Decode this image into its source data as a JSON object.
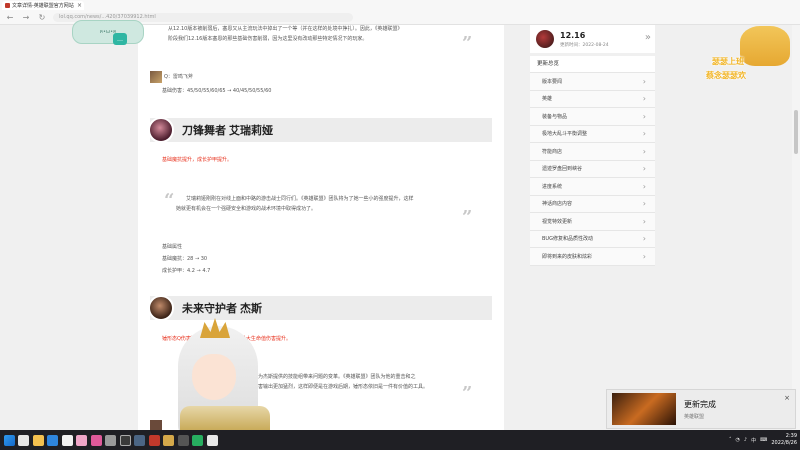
{
  "browser": {
    "tab_title": "文章详情-英雄联盟官方网站",
    "tab_close": "×",
    "url": "lol.qq.com/news/...420/37039912.html",
    "nav_back": "←",
    "nav_forward": "→",
    "nav_reload": "↻"
  },
  "article": {
    "quote1_text_a": "从12.10版本被削弱后，塞恩又从主流玩法中掉出了一个等（并在这样的处境中挣扎）。因此，《英雄联盟》",
    "quote1_text_b": "阶段我们12.16版本塞恩的那些基础伤害削弱，因为这里没有改动那些特定情况下的玩家。",
    "skill_label": "Q：雷鸣飞斧",
    "skill_values": "基础伤害：45/50/55/60/65 → 40/45/50/55/60",
    "champ1_name": "刀锋舞者 艾瑞莉娅",
    "champ1_red": "基础魔抗提升，成长护甲提升。",
    "champ1_quote_a": "艾瑞莉娅刚刚在对线上面和中路的游击战士同行们。《英雄联盟》团队将为了她一些小的强度提升，这样",
    "champ1_quote_b": "她就更有机会在一个强硬安全和游戏的战术环境中取得成功了。",
    "champ1_stats_title": "基础属性",
    "champ1_stat1": "基础魔抗：28 → 30",
    "champ1_stat2": "成长护甲：4.2 → 4.7",
    "champ2_name": "未来守护者 杰斯",
    "champ2_red": "锤形态Q伤害提升……打造成的目标最大生命值伤害提升。",
    "champ2_quote_a": "……之前那种为杰斯提供的技能组带来问题的变革。《英雄联盟》团队为他的重击和之",
    "champ2_quote_b": "……让他的伤害输出更加猛烈，这样即便是在游戏后期，锤形态依旧是一件有价值的工具。"
  },
  "sidebar": {
    "patch_version": "12.16",
    "patch_date": "更新时间：2022-08-24",
    "toc_title": "更新总览",
    "toc_items": [
      "版本要闻",
      "英雄",
      "装备与物品",
      "极地大乱斗平衡调整",
      "符能商店",
      "遗迹罗盘回到峡谷",
      "进度系统",
      "神话商店内容",
      "视觉特效更新",
      "BUG修复和品质性改动",
      "即将到来的皮肤和炫彩"
    ]
  },
  "stream": {
    "logo_text": "ฅ•ω•ฅ",
    "chat_icon": "…",
    "sticker_line1": "瑟瑟上班",
    "sticker_line2": "蔡念瑟瑟欢"
  },
  "toast": {
    "title": "更新完成",
    "subtitle": "英雄联盟",
    "close": "×"
  },
  "taskbar": {
    "lang": "中",
    "time": "2:39",
    "date": "2022/8/26"
  }
}
